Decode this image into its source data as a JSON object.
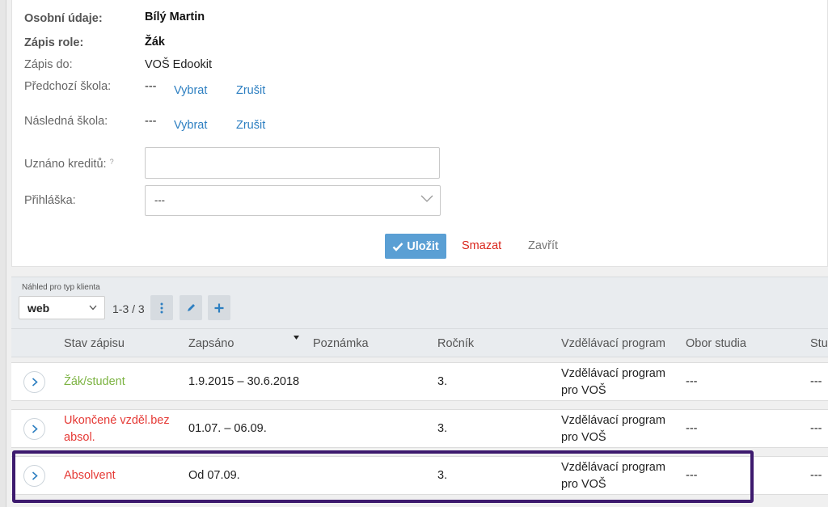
{
  "form": {
    "personal_label": "Osobní údaje:",
    "personal_value": "Bílý Martin",
    "role_label": "Zápis role:",
    "role_value": "Žák",
    "enrolled_to_label": "Zápis do:",
    "enrolled_to_value": "VOŠ Edookit",
    "prev_school_label": "Předchozí škola:",
    "prev_school_value": "---",
    "next_school_label": "Následná škola:",
    "next_school_value": "---",
    "choose_link": "Vybrat",
    "cancel_link": "Zrušit",
    "credits_label": "Uznáno kreditů:",
    "credits_help": "?",
    "credits_value": "",
    "application_label": "Přihláška:",
    "application_value": "---",
    "save_label": "Uložit",
    "delete_label": "Smazat",
    "close_label": "Zavřít"
  },
  "toolbar": {
    "view_label": "Náhled pro typ klienta",
    "view_value": "web",
    "pager": "1-3 / 3"
  },
  "grid": {
    "columns": [
      "Stav zápisu",
      "Zapsáno",
      "Poznámka",
      "Ročník",
      "Vzdělávací program",
      "Obor studia",
      "Stu"
    ],
    "rows": [
      {
        "status": "Žák/student",
        "status_color": "#7cb342",
        "enrolled": "1.9.2015 – 30.6.2018",
        "note": "",
        "year": "3.",
        "program_l1": "Vzdělávací program",
        "program_l2": "pro VOŠ",
        "field": "---",
        "stu": "---"
      },
      {
        "status_l1": "Ukončené vzděl.bez",
        "status_l2": "absol.",
        "status_color": "#e53935",
        "enrolled": "01.07. – 06.09.",
        "note": "",
        "year": "3.",
        "program_l1": "Vzdělávací program",
        "program_l2": "pro VOŠ",
        "field": "---",
        "stu": "---"
      },
      {
        "status": "Absolvent",
        "status_color": "#e53935",
        "enrolled": "Od 07.09.",
        "note": "",
        "year": "3.",
        "program_l1": "Vzdělávací program",
        "program_l2": "pro VOŠ",
        "field": "---",
        "stu": "---"
      }
    ]
  },
  "icons": {
    "save": "check-icon",
    "more": "vertical-dots-icon",
    "edit": "pencil-icon",
    "add": "plus-icon",
    "expand": "chevron-right-icon",
    "select": "chevron-down-icon"
  },
  "colors": {
    "accent": "#5a9fd4",
    "link": "#2d7fc1",
    "danger": "#d9261c",
    "highlight": "#3d1a6e"
  }
}
